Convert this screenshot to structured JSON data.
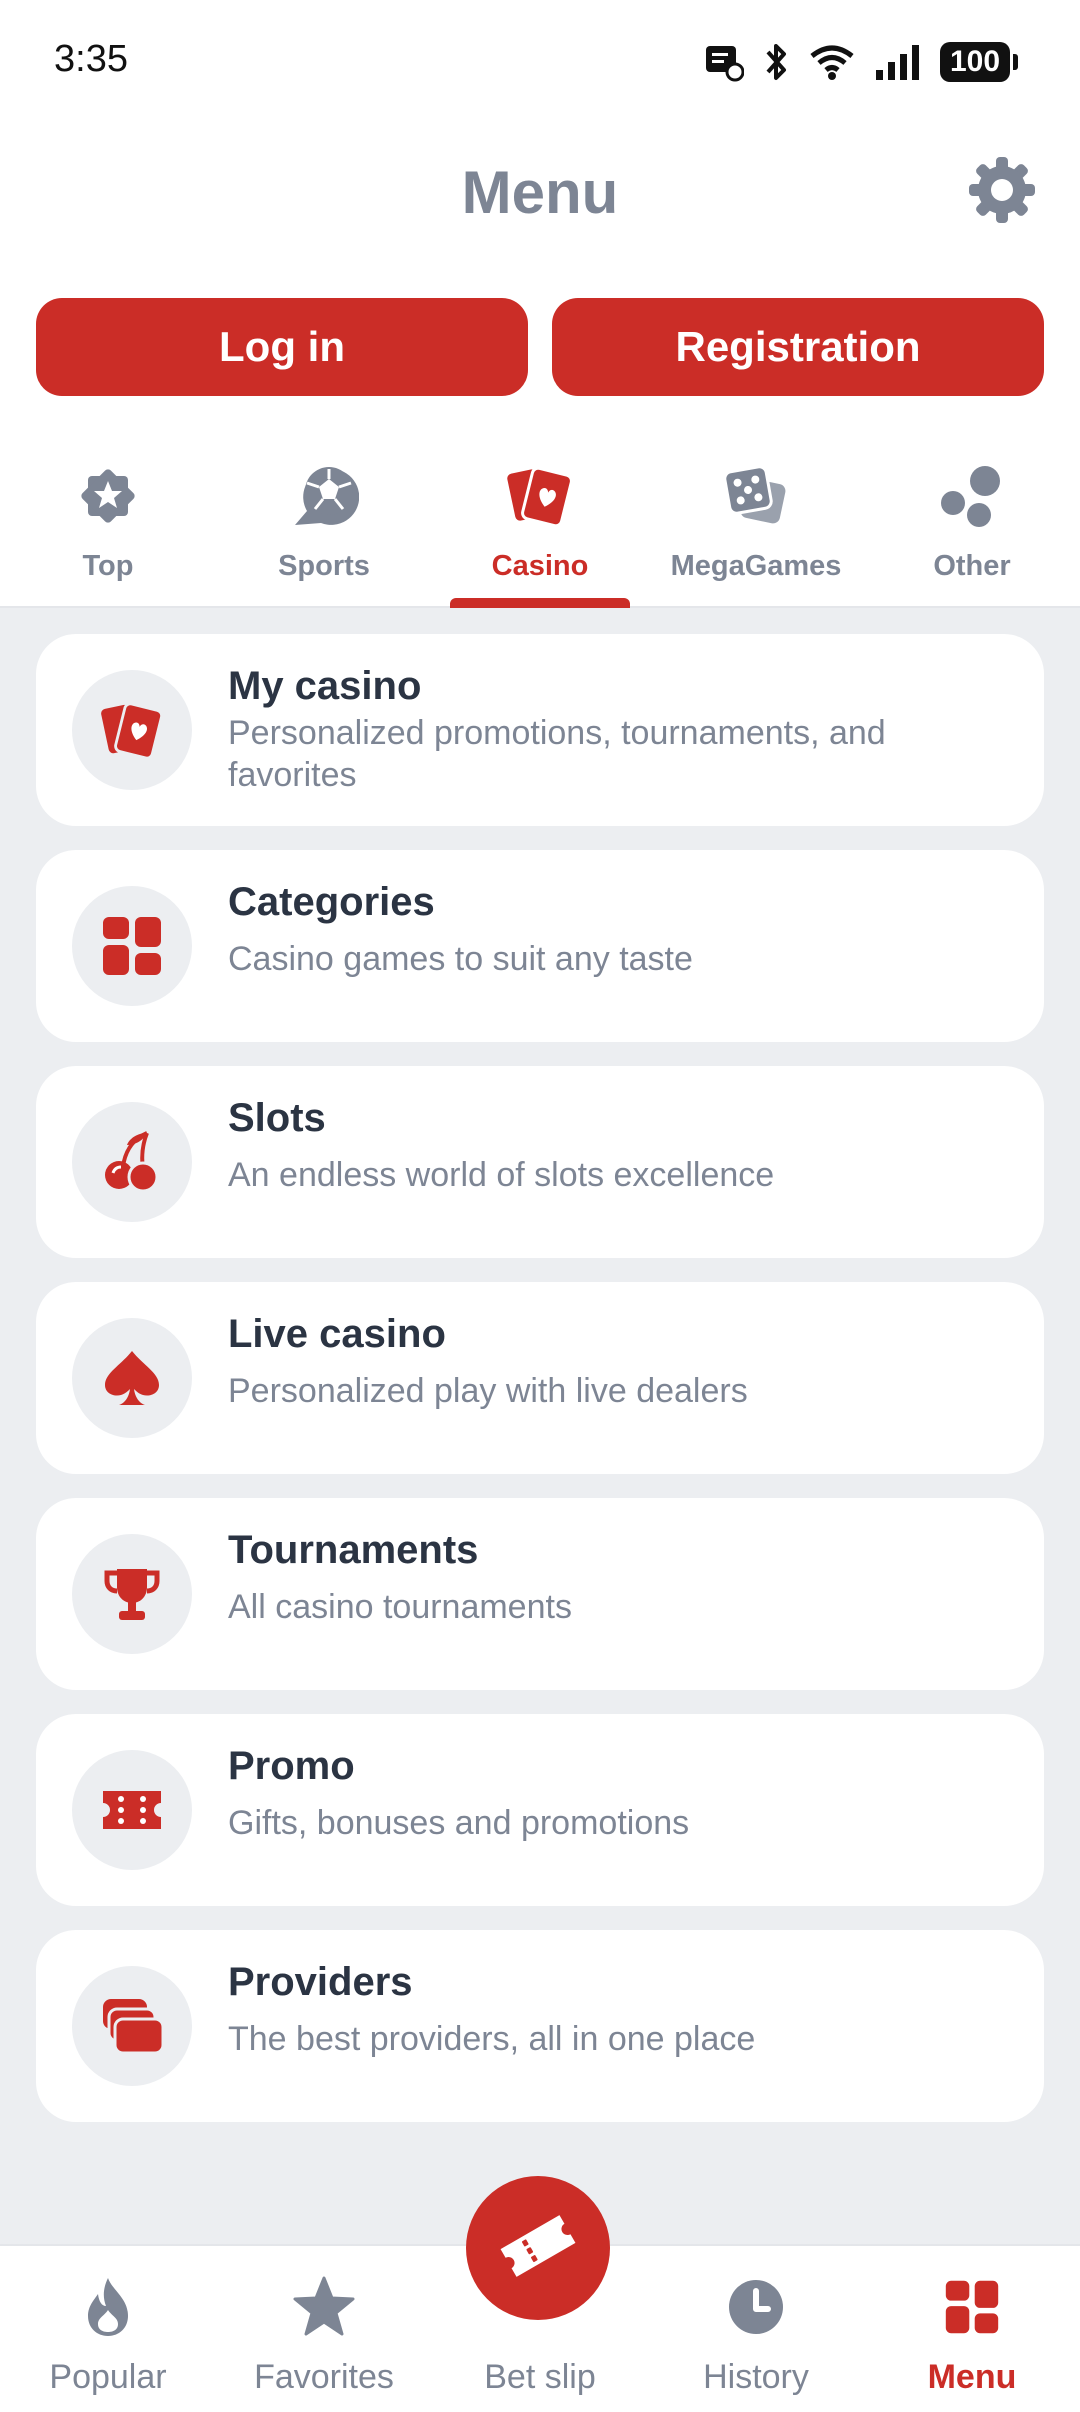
{
  "status_bar": {
    "time": "3:35",
    "battery": "100"
  },
  "header": {
    "title": "Menu"
  },
  "auth": {
    "login_label": "Log in",
    "register_label": "Registration"
  },
  "tabs": [
    {
      "label": "Top",
      "icon": "star-badge-icon"
    },
    {
      "label": "Sports",
      "icon": "ball-icon"
    },
    {
      "label": "Casino",
      "icon": "cards-icon",
      "active": true
    },
    {
      "label": "MegaGames",
      "icon": "dice-icon"
    },
    {
      "label": "Other",
      "icon": "dots-icon"
    }
  ],
  "items": [
    {
      "title": "My casino",
      "subtitle": "Personalized promotions, tournaments, and favorites",
      "icon": "cards-icon"
    },
    {
      "title": "Categories",
      "subtitle": "Casino games to suit any taste",
      "icon": "grid-icon"
    },
    {
      "title": "Slots",
      "subtitle": "An endless world of slots excellence",
      "icon": "cherry-icon"
    },
    {
      "title": "Live casino",
      "subtitle": "Personalized play with live dealers",
      "icon": "spade-icon"
    },
    {
      "title": "Tournaments",
      "subtitle": "All casino tournaments",
      "icon": "trophy-icon"
    },
    {
      "title": "Promo",
      "subtitle": "Gifts, bonuses and promotions",
      "icon": "ticket-icon"
    },
    {
      "title": "Providers",
      "subtitle": "The best providers, all in one place",
      "icon": "stack-icon"
    }
  ],
  "bottom_nav": [
    {
      "label": "Popular",
      "icon": "fire-icon"
    },
    {
      "label": "Favorites",
      "icon": "star-icon"
    },
    {
      "label": "Bet slip",
      "icon": "ticket-icon"
    },
    {
      "label": "History",
      "icon": "clock-icon"
    },
    {
      "label": "Menu",
      "icon": "grid-icon",
      "active": true
    }
  ],
  "colors": {
    "accent": "#cb2d27",
    "muted": "#7d8594",
    "background": "#eceef1",
    "text": "#2b3443"
  }
}
